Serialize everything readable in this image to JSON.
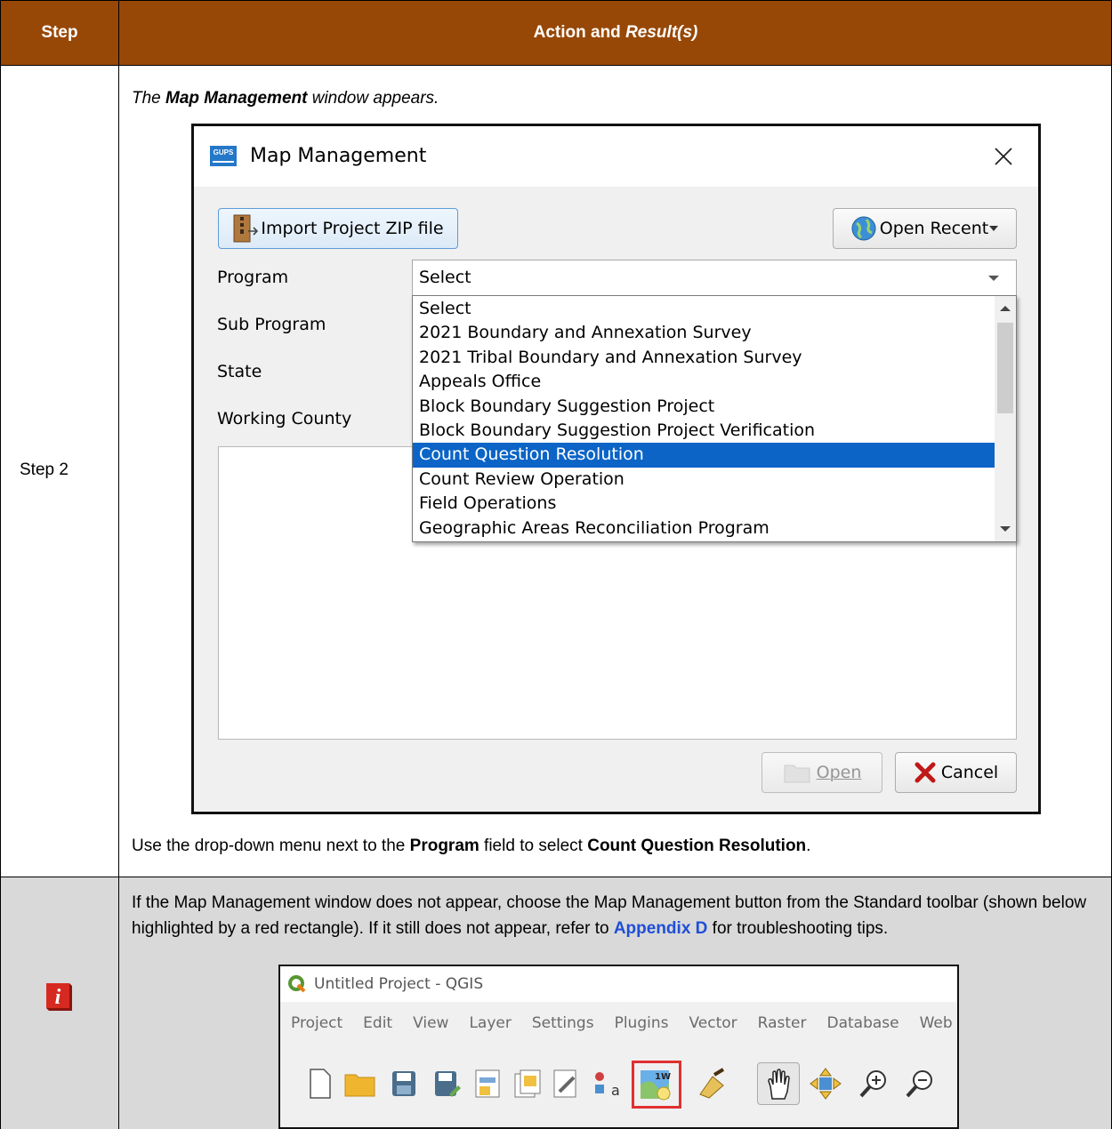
{
  "table": {
    "header_step": "Step",
    "header_action": "Action and ",
    "header_result": "Result(s)",
    "step_label": "Step 2"
  },
  "step2": {
    "intro_pre": "The ",
    "intro_bold": "Map Management",
    "intro_post": " window appears.",
    "instruction_pre": "Use the drop-down menu next to the ",
    "instruction_program": "Program",
    "instruction_mid": " field to select ",
    "instruction_value": "Count Question Resolution",
    "instruction_end": "."
  },
  "dialog": {
    "logo_text": "GUPS",
    "title": "Map Management",
    "import_button": "Import Project ZIP file",
    "open_recent_button": "Open Recent",
    "labels": [
      "Program",
      "Sub Program",
      "State",
      "Working County"
    ],
    "program_value": "Select",
    "options": [
      "Select",
      "2021 Boundary and Annexation Survey",
      "2021 Tribal Boundary and Annexation Survey",
      "Appeals Office",
      "Block Boundary Suggestion Project",
      "Block Boundary Suggestion Project Verification",
      "Count Question Resolution",
      "Count Review Operation",
      "Field Operations",
      "Geographic Areas Reconciliation Program"
    ],
    "selected_option": "Count Question Resolution",
    "open_button": "Open",
    "cancel_button": "Cancel"
  },
  "note": {
    "text_pre": "If the Map Management window does not appear, choose the Map Management button from the Standard toolbar (shown below highlighted by a red rectangle). If it still does not appear, refer to ",
    "link": "Appendix D",
    "text_post": " for troubleshooting tips."
  },
  "qgis": {
    "title": "Untitled Project - QGIS",
    "menu": [
      "Project",
      "Edit",
      "View",
      "Layer",
      "Settings",
      "Plugins",
      "Vector",
      "Raster",
      "Database",
      "Web"
    ]
  },
  "colors": {
    "header_bg": "#974806",
    "note_bg": "#d9d9d9",
    "selection": "#0b64c6",
    "highlight": "#e03030",
    "link": "#1f4ed8"
  }
}
